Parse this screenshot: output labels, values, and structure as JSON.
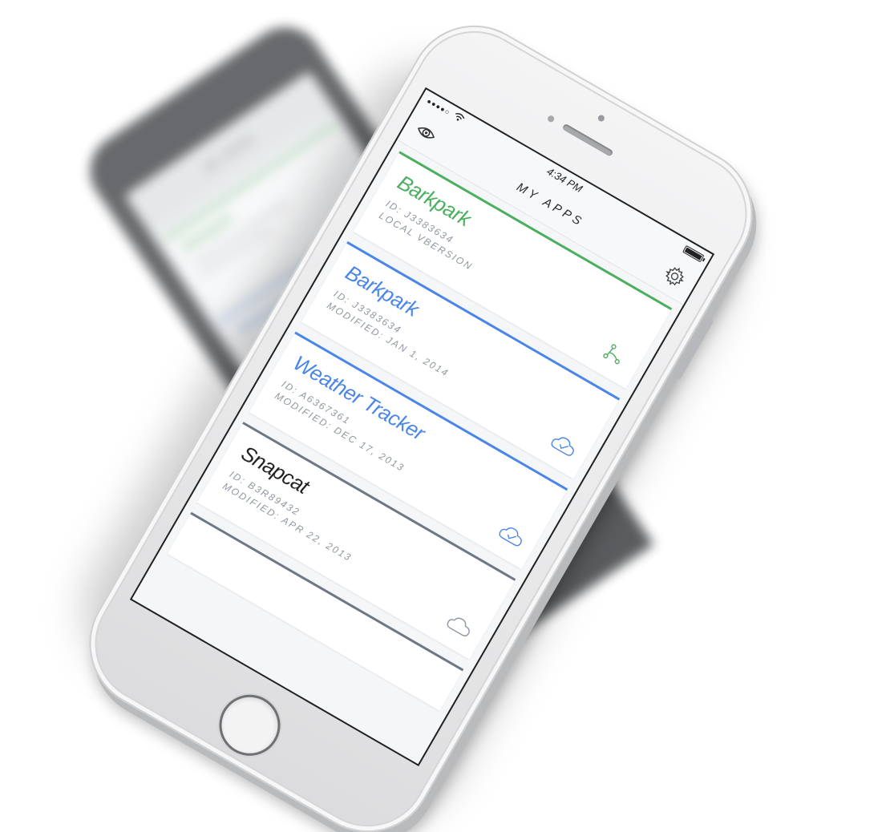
{
  "status_bar": {
    "signal": "●●●●○",
    "time": "4:34 PM",
    "battery_level": 1.0
  },
  "nav": {
    "title": "MY APPS",
    "left_icon": "eye-icon",
    "right_icon": "gear-icon"
  },
  "apps": [
    {
      "name": "Barkpark",
      "id_line": "ID: J3383634",
      "detail_line": "LOCAL VBERSION",
      "color": "#4caf60",
      "title_color": "#4caf60",
      "icon": "fork-icon"
    },
    {
      "name": "Barkpark",
      "id_line": "ID: J3383634",
      "detail_line": "MODIFIED: JAN 1, 2014",
      "color": "#4a86e8",
      "title_color": "#4a86e8",
      "icon": "cloud-check-icon"
    },
    {
      "name": "Weather Tracker",
      "id_line": "ID: A6367361",
      "detail_line": "MODIFIED: DEC 17, 2013",
      "color": "#4a86e8",
      "title_color": "#4a86e8",
      "icon": "cloud-check-icon"
    },
    {
      "name": "Snapcat",
      "id_line": "ID: B3R89432",
      "detail_line": "MODIFIED: APR 22, 2013",
      "color": "#6d7785",
      "title_color": "#222222",
      "icon": "cloud-icon"
    }
  ],
  "background_phone": {
    "title": "MY APPS",
    "cards": [
      {
        "name": "Barkpark"
      },
      {
        "name": "Barkpark"
      }
    ]
  }
}
